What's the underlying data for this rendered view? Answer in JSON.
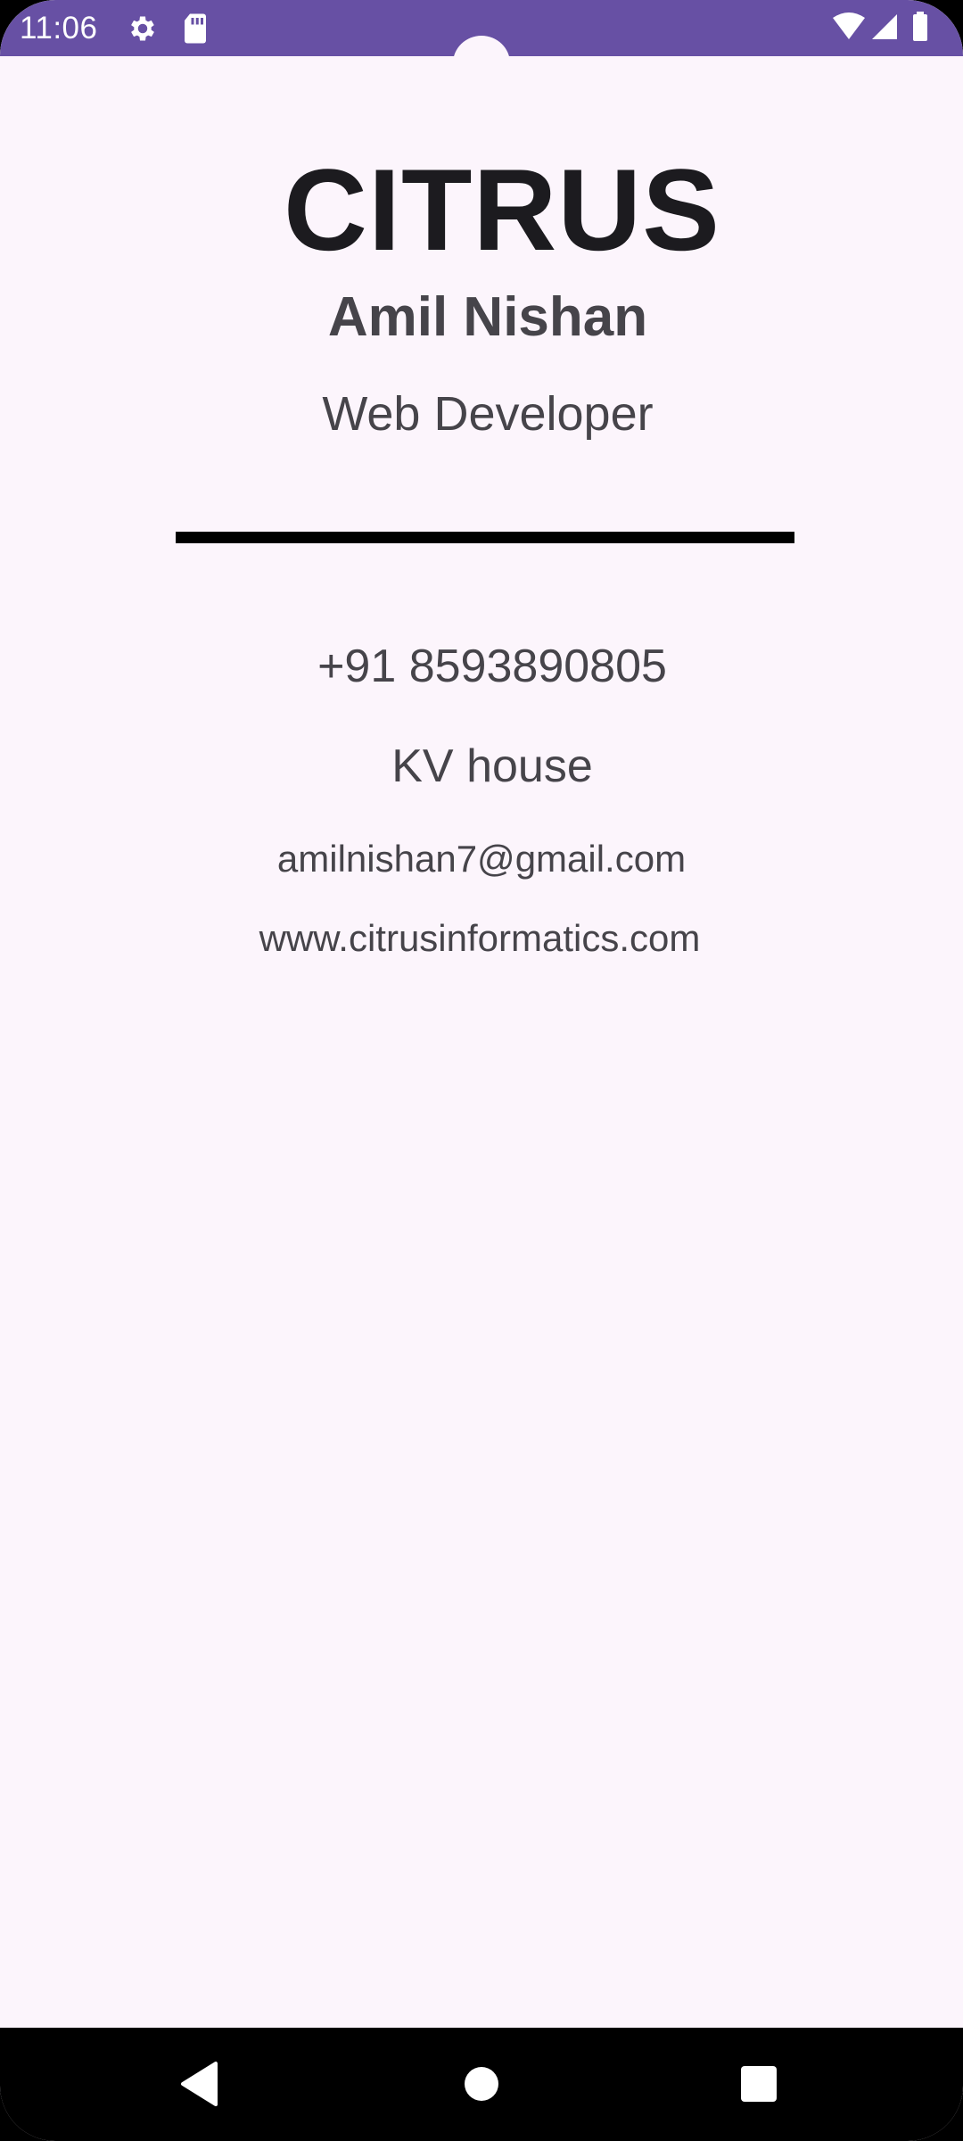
{
  "status_bar": {
    "time": "11:06",
    "left_icons": [
      "settings-icon",
      "sd-card-icon"
    ],
    "right_icons": [
      "wifi-icon",
      "cellular-signal-icon",
      "battery-icon"
    ],
    "background_color": "#6750a4"
  },
  "card": {
    "company": "CITRUS",
    "name": "Amil Nishan",
    "job_title": "Web Developer",
    "phone": "+91 8593890805",
    "address": "KV house",
    "email": "amilnishan7@gmail.com",
    "website": "www.citrusinformatics.com"
  },
  "nav_bar": {
    "buttons": [
      "back-icon",
      "home-icon",
      "recents-icon"
    ]
  },
  "colors": {
    "background": "#fcf5fc",
    "primary_text": "#1c1b1f",
    "secondary_text": "#46444a",
    "divider": "#000000"
  }
}
